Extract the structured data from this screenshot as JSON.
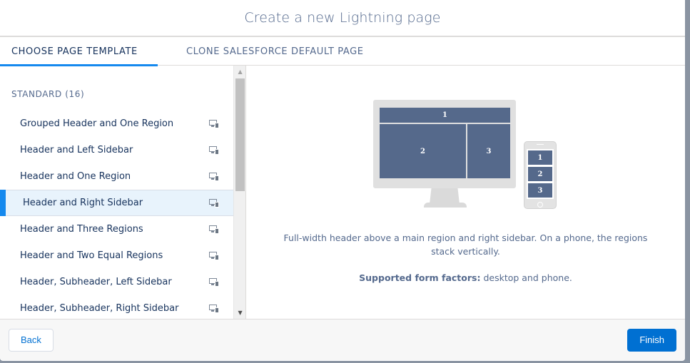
{
  "modal": {
    "title": "Create a new Lightning page"
  },
  "tabs": [
    {
      "label": "Choose Page Template",
      "active": true
    },
    {
      "label": "Clone Salesforce Default Page",
      "active": false
    }
  ],
  "template_list": {
    "section_title": "STANDARD (16)",
    "items": [
      {
        "label": "Grouped Header and One Region",
        "icon": "desktop-and-phone-icon",
        "selected": false
      },
      {
        "label": "Header and Left Sidebar",
        "icon": "desktop-and-phone-icon",
        "selected": false
      },
      {
        "label": "Header and One Region",
        "icon": "desktop-and-phone-icon",
        "selected": false
      },
      {
        "label": "Header and Right Sidebar",
        "icon": "desktop-and-phone-icon",
        "selected": true
      },
      {
        "label": "Header and Three Regions",
        "icon": "desktop-and-phone-icon",
        "selected": false
      },
      {
        "label": "Header and Two Equal Regions",
        "icon": "desktop-and-phone-icon",
        "selected": false
      },
      {
        "label": "Header, Subheader, Left Sidebar",
        "icon": "desktop-and-phone-icon",
        "selected": false
      },
      {
        "label": "Header, Subheader, Right Sidebar",
        "icon": "desktop-and-phone-icon",
        "selected": false
      }
    ]
  },
  "preview": {
    "desktop_regions": [
      "1",
      "2",
      "3"
    ],
    "phone_regions": [
      "1",
      "2",
      "3"
    ],
    "description": "Full-width header above a main region and right sidebar. On a phone, the regions stack vertically.",
    "supported_label": "Supported form factors:",
    "supported_value": " desktop and phone."
  },
  "footer": {
    "back_label": "Back",
    "finish_label": "Finish"
  },
  "colors": {
    "accent": "#1589ee",
    "brand_button": "#0070d2",
    "region_fill": "#55698b",
    "selected_row_bg": "#e8f3fc"
  }
}
